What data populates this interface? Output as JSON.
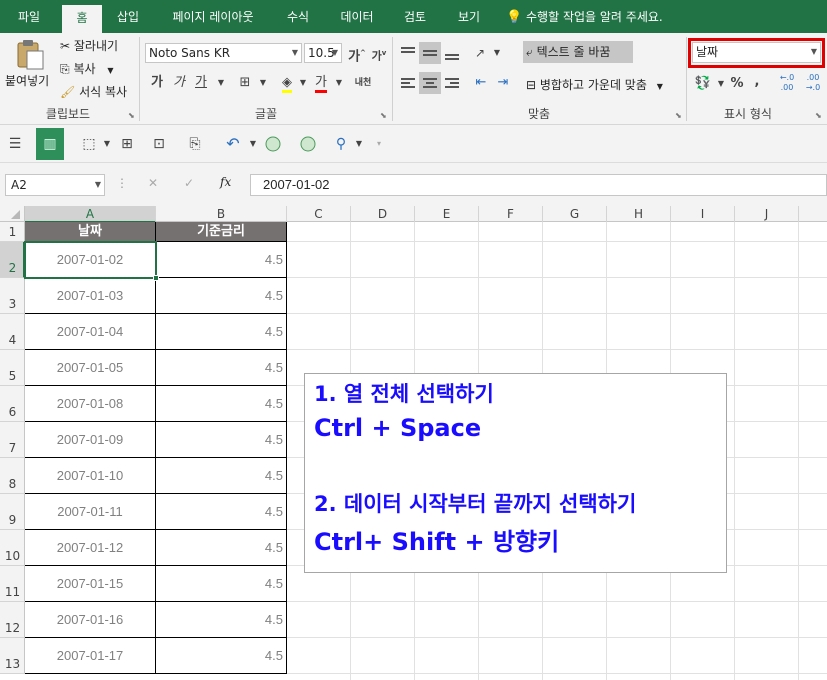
{
  "tabs": [
    "파일",
    "홈",
    "삽입",
    "페이지 레이아웃",
    "수식",
    "데이터",
    "검토",
    "보기"
  ],
  "active_tab": "홈",
  "tell_me": "수행할 작업을 알려 주세요.",
  "clipboard": {
    "paste": "붙여넣기",
    "cut": "잘라내기",
    "copy": "복사",
    "format_painter": "서식 복사",
    "group": "클립보드"
  },
  "font": {
    "name": "Noto Sans KR",
    "size": "10.5",
    "bold": "가",
    "italic": "가",
    "underline": "가",
    "phonetic": "내천",
    "group": "글꼴"
  },
  "alignment": {
    "wrap_text": "텍스트 줄 바꿈",
    "merge_center": "병합하고 가운데 맞춤",
    "group": "맞춤"
  },
  "number": {
    "format": "날짜",
    "percent": "%",
    "comma": ",",
    "group": "표시 형식"
  },
  "formula_bar": {
    "name_box": "A2",
    "cancel": "✕",
    "enter": "✓",
    "fx": "fx",
    "value": "2007-01-02"
  },
  "columns": [
    "A",
    "B",
    "C",
    "D",
    "E",
    "F",
    "G",
    "H",
    "I",
    "J"
  ],
  "selected_column": "A",
  "rows": [
    "1",
    "2",
    "3",
    "4",
    "5",
    "6",
    "7",
    "8",
    "9",
    "10",
    "11",
    "12",
    "13"
  ],
  "selected_row": "2",
  "table": {
    "headers": [
      "날짜",
      "기준금리"
    ],
    "data": [
      [
        "2007-01-02",
        "4.5"
      ],
      [
        "2007-01-03",
        "4.5"
      ],
      [
        "2007-01-04",
        "4.5"
      ],
      [
        "2007-01-05",
        "4.5"
      ],
      [
        "2007-01-08",
        "4.5"
      ],
      [
        "2007-01-09",
        "4.5"
      ],
      [
        "2007-01-10",
        "4.5"
      ],
      [
        "2007-01-11",
        "4.5"
      ],
      [
        "2007-01-12",
        "4.5"
      ],
      [
        "2007-01-15",
        "4.5"
      ],
      [
        "2007-01-16",
        "4.5"
      ],
      [
        "2007-01-17",
        "4.5"
      ]
    ]
  },
  "note": {
    "line1": "1. 열 전체 선택하기",
    "line2": "Ctrl + Space",
    "line3": "2. 데이터 시작부터 끝까지 선택하기",
    "line4": "Ctrl+ Shift + 방향키"
  },
  "colors": {
    "excel_green": "#217346",
    "header_fill": "#767171",
    "note_text": "#1a0dff",
    "highlight_box": "#e00000"
  }
}
